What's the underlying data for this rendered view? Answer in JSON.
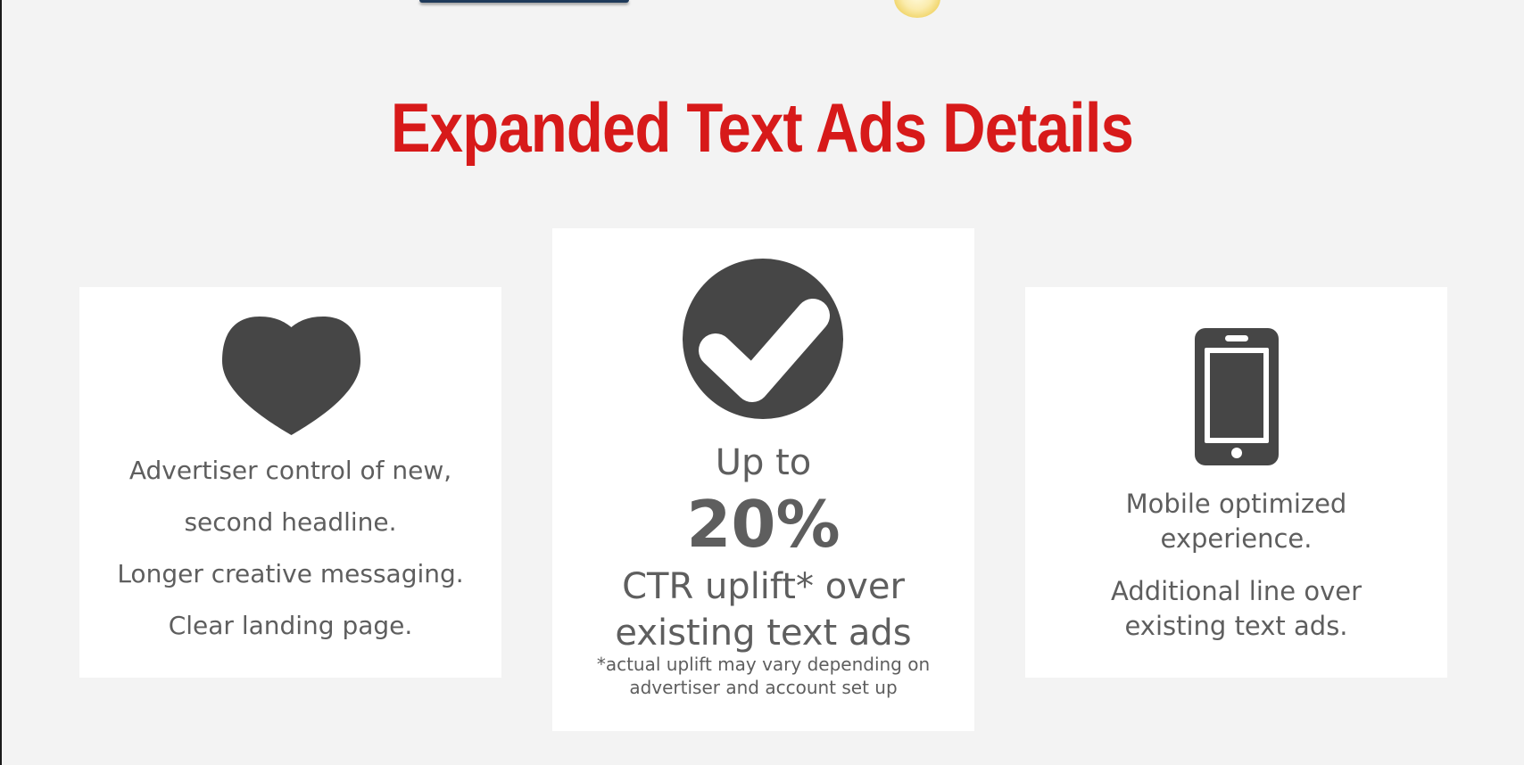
{
  "title": "Expanded Text Ads Details",
  "colors": {
    "title": "#d71a1a",
    "icon": "#464646",
    "text": "#5e5e5e",
    "card": "#ffffff",
    "background": "#f3f3f3"
  },
  "cards": {
    "left": {
      "icon": "heart-icon",
      "lines": [
        "Advertiser control of new,",
        "second headline.",
        "Longer creative messaging.",
        "Clear landing page."
      ]
    },
    "center": {
      "icon": "check-circle-icon",
      "up_to": "Up to",
      "percent": "20%",
      "ctr_line1": "CTR uplift* over",
      "ctr_line2": "existing text ads",
      "footnote_line1": "*actual uplift may vary depending on",
      "footnote_line2": "advertiser and account set up"
    },
    "right": {
      "icon": "smartphone-icon",
      "block1_line1": "Mobile optimized",
      "block1_line2": "experience.",
      "block2_line1": "Additional line over",
      "block2_line2": "existing text ads."
    }
  }
}
